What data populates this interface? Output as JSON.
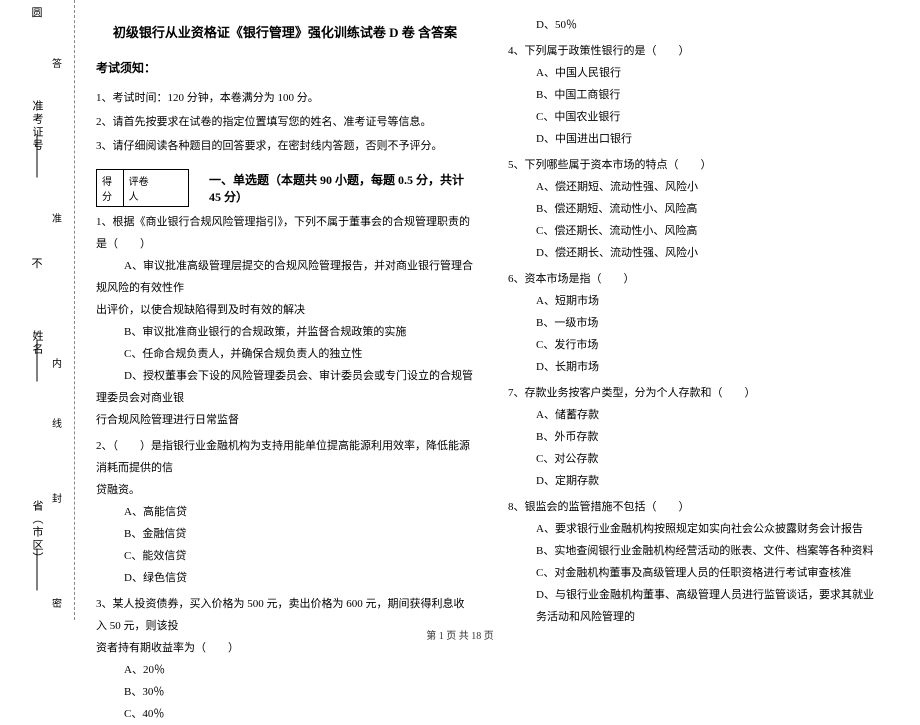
{
  "gutter": {
    "top_char": "圆",
    "field1": "准考证号",
    "field2": "姓名",
    "field3": "省（市区）",
    "lbl_da": "答",
    "lbl_zhun": "准",
    "lbl_bu": "不",
    "lbl_nei": "内",
    "lbl_xian": "线",
    "lbl_feng": "封",
    "lbl_mi": "密"
  },
  "title": "初级银行从业资格证《银行管理》强化训练试卷 D 卷  含答案",
  "notice_head": "考试须知：",
  "notice": {
    "n1": "1、考试时间：120 分钟，本卷满分为 100 分。",
    "n2": "2、请首先按要求在试卷的指定位置填写您的姓名、准考证号等信息。",
    "n3": "3、请仔细阅读各种题目的回答要求，在密封线内答题，否则不予评分。"
  },
  "score": {
    "c1": "得分",
    "c2": "评卷人"
  },
  "section1": "一、单选题（本题共 90 小题，每题 0.5 分，共计 45 分）",
  "q1": {
    "stem": "1、根据《商业银行合规风险管理指引》，下列不属于董事会的合规管理职责的是（　　）",
    "a_p1": "A、审议批准高级管理层提交的合规风险管理报告，并对商业银行管理合规风险的有效性作",
    "a_p2": "出评价，以使合规缺陷得到及时有效的解决",
    "b": "B、审议批准商业银行的合规政策，并监督合规政策的实施",
    "c": "C、任命合规负责人，并确保合规负责人的独立性",
    "d_p1": "D、授权董事会下设的风险管理委员会、审计委员会或专门设立的合规管理委员会对商业银",
    "d_p2": "行合规风险管理进行日常监督"
  },
  "q2": {
    "stem_p1": "2、（　　）是指银行业金融机构为支持用能单位提高能源利用效率，降低能源消耗而提供的信",
    "stem_p2": "贷融资。",
    "a": "A、高能信贷",
    "b": "B、金融信贷",
    "c": "C、能效信贷",
    "d": "D、绿色信贷"
  },
  "q3": {
    "stem_p1": "3、某人投资债券，买入价格为 500 元，卖出价格为 600 元，期间获得利息收入 50 元，则该投",
    "stem_p2": "资者持有期收益率为（　　）",
    "a": "A、20％",
    "b": "B、30％",
    "c": "C、40％",
    "d": "D、50％"
  },
  "q4": {
    "stem": "4、下列属于政策性银行的是（　　）",
    "a": "A、中国人民银行",
    "b": "B、中国工商银行",
    "c": "C、中国农业银行",
    "d": "D、中国进出口银行"
  },
  "q5": {
    "stem": "5、下列哪些属于资本市场的特点（　　）",
    "a": "A、偿还期短、流动性强、风险小",
    "b": "B、偿还期短、流动性小、风险高",
    "c": "C、偿还期长、流动性小、风险高",
    "d": "D、偿还期长、流动性强、风险小"
  },
  "q6": {
    "stem": "6、资本市场是指（　　）",
    "a": "A、短期市场",
    "b": "B、一级市场",
    "c": "C、发行市场",
    "d": "D、长期市场"
  },
  "q7": {
    "stem": "7、存款业务按客户类型，分为个人存款和（　　）",
    "a": "A、储蓄存款",
    "b": "B、外币存款",
    "c": "C、对公存款",
    "d": "D、定期存款"
  },
  "q8": {
    "stem": "8、银监会的监管措施不包括（　　）",
    "a": "A、要求银行业金融机构按照规定如实向社会公众披露财务会计报告",
    "b": "B、实地查阅银行业金融机构经营活动的账表、文件、档案等各种资料",
    "c": "C、对金融机构董事及高级管理人员的任职资格进行考试审查核准",
    "d": "D、与银行业金融机构董事、高级管理人员进行监管谈话，要求其就业务活动和风险管理的"
  },
  "footer": "第 1 页  共 18 页"
}
